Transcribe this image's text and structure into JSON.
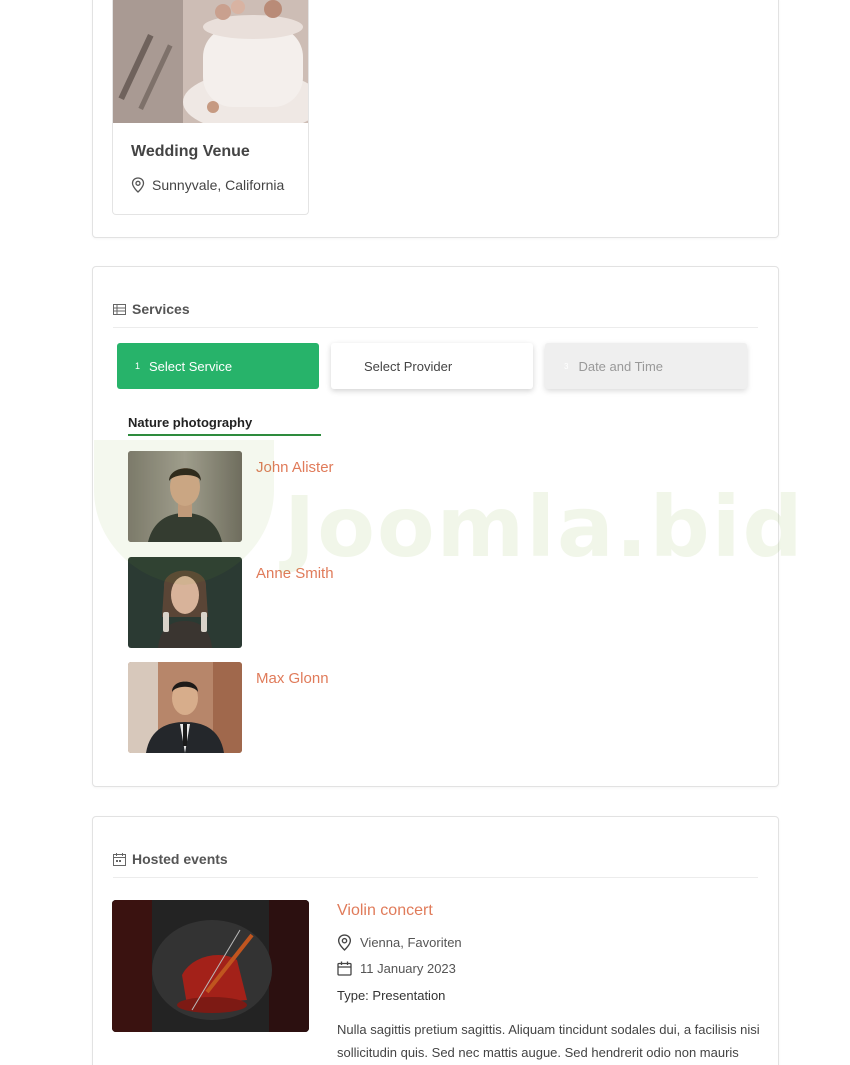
{
  "venue": {
    "title": "Wedding Venue",
    "location": "Sunnyvale, California",
    "icon": "location-pin-icon"
  },
  "services": {
    "heading": "Services",
    "heading_icon": "table-icon",
    "steps": [
      {
        "number": "1",
        "label": "Select Service",
        "state": "active"
      },
      {
        "number": "",
        "label": "Select Provider",
        "state": "normal"
      },
      {
        "number": "3",
        "label": "Date and Time",
        "state": "disabled"
      }
    ],
    "category": "Nature photography",
    "providers": [
      {
        "name": "John Alister"
      },
      {
        "name": "Anne Smith"
      },
      {
        "name": "Max Glonn"
      }
    ]
  },
  "watermark": {
    "text": "Joomla.bid"
  },
  "events": {
    "heading": "Hosted events",
    "heading_icon": "calendar-icon",
    "items": [
      {
        "title": "Violin concert",
        "location": "Vienna, Favoriten",
        "date": "11 January 2023",
        "type": "Type: Presentation",
        "description": "Nulla sagittis pretium sagittis. Aliquam tincidunt sodales dui, a facilisis nisi sollicitudin quis. Sed nec mattis augue. Sed hendrerit odio non mauris"
      }
    ]
  },
  "colors": {
    "accent_green": "#27b36a",
    "link_orange": "#e07b5a",
    "tab_underline": "#2e8b3e"
  }
}
